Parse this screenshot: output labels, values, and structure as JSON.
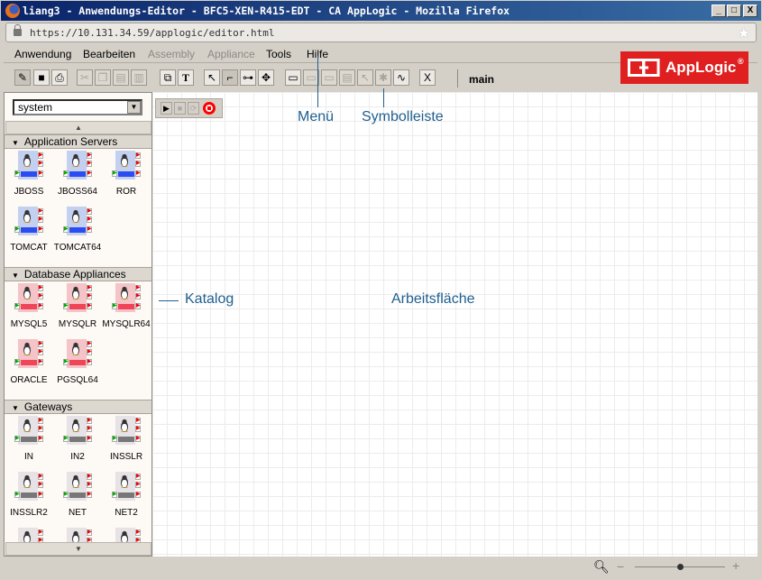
{
  "window": {
    "title": "liang3 - Anwendungs-Editor - BFC5-XEN-R415-EDT - CA AppLogic - Mozilla Firefox",
    "minimize": "_",
    "maximize": "□",
    "close": "X"
  },
  "browser": {
    "url": "https://10.131.34.59/applogic/editor.html"
  },
  "menu": [
    {
      "label": "Anwendung",
      "enabled": true
    },
    {
      "label": "Bearbeiten",
      "enabled": true
    },
    {
      "label": "Assembly",
      "enabled": false
    },
    {
      "label": "Appliance",
      "enabled": false
    },
    {
      "label": "Tools",
      "enabled": true
    },
    {
      "label": "Hilfe",
      "enabled": true
    }
  ],
  "toolbar": {
    "current_assembly": "main",
    "close_glyph": "X",
    "text_glyph": "T"
  },
  "logo": {
    "text": "AppLogic",
    "registered": "®"
  },
  "catalog": {
    "selected": "system",
    "sections": [
      {
        "title": "Application Servers",
        "kind": "app",
        "items": [
          "JBOSS",
          "JBOSS64",
          "ROR",
          "TOMCAT",
          "TOMCAT64"
        ]
      },
      {
        "title": "Database Appliances",
        "kind": "db",
        "items": [
          "MYSQL5",
          "MYSQLR",
          "MYSQLR64",
          "ORACLE",
          "PGSQL64"
        ]
      },
      {
        "title": "Gateways",
        "kind": "gw",
        "items": [
          "IN",
          "IN2",
          "INSSLR",
          "INSSLR2",
          "NET",
          "NET2",
          "",
          "",
          ""
        ]
      }
    ]
  },
  "colors": {
    "app_bg": "#c4d0f0",
    "app_bar": "#2a4cf0",
    "db_bg": "#f4c4c8",
    "db_bar": "#f04458",
    "gw_bg": "#e6e2e6",
    "gw_bar": "#777777",
    "annotation": "#1f5f8f",
    "logo": "#e02020"
  },
  "annotations": {
    "menu": "Menü",
    "toolbar": "Symbolleiste",
    "catalog": "Katalog",
    "workspace": "Arbeitsfläche"
  },
  "status": {
    "zoom_minus": "−",
    "zoom_plus": "+",
    "zoom_level": 0.5
  }
}
